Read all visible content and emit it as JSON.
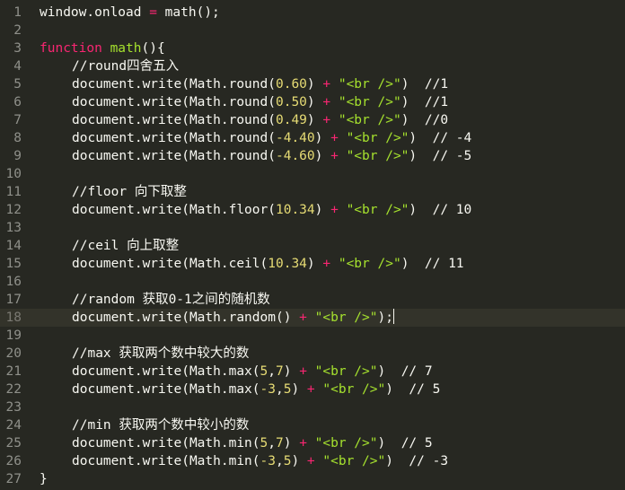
{
  "editor": {
    "active_line": 18,
    "lines": [
      {
        "no": "1",
        "tokens": [
          [
            "pl",
            "window.onload "
          ],
          [
            "op",
            "="
          ],
          [
            "pl",
            " math();"
          ]
        ]
      },
      {
        "no": "2",
        "tokens": []
      },
      {
        "no": "3",
        "tokens": [
          [
            "kw",
            "function "
          ],
          [
            "fn",
            "math"
          ],
          [
            "pl",
            "(){"
          ]
        ]
      },
      {
        "no": "4",
        "indent": 1,
        "tokens": [
          [
            "cm",
            "//round四舍五入"
          ]
        ]
      },
      {
        "no": "5",
        "indent": 1,
        "tokens": [
          [
            "pl",
            "document.write(Math.round("
          ],
          [
            "num",
            "0.60"
          ],
          [
            "pl",
            ") "
          ],
          [
            "op",
            "+"
          ],
          [
            "pl",
            " "
          ],
          [
            "str",
            "\"<br />\""
          ],
          [
            "pl",
            ")  //1"
          ]
        ]
      },
      {
        "no": "6",
        "indent": 1,
        "tokens": [
          [
            "pl",
            "document.write(Math.round("
          ],
          [
            "num",
            "0.50"
          ],
          [
            "pl",
            ") "
          ],
          [
            "op",
            "+"
          ],
          [
            "pl",
            " "
          ],
          [
            "str",
            "\"<br />\""
          ],
          [
            "pl",
            ")  //1"
          ]
        ]
      },
      {
        "no": "7",
        "indent": 1,
        "tokens": [
          [
            "pl",
            "document.write(Math.round("
          ],
          [
            "num",
            "0.49"
          ],
          [
            "pl",
            ") "
          ],
          [
            "op",
            "+"
          ],
          [
            "pl",
            " "
          ],
          [
            "str",
            "\"<br />\""
          ],
          [
            "pl",
            ")  //0"
          ]
        ]
      },
      {
        "no": "8",
        "indent": 1,
        "tokens": [
          [
            "pl",
            "document.write(Math.round("
          ],
          [
            "num",
            "-4.40"
          ],
          [
            "pl",
            ") "
          ],
          [
            "op",
            "+"
          ],
          [
            "pl",
            " "
          ],
          [
            "str",
            "\"<br />\""
          ],
          [
            "pl",
            ")  // -4"
          ]
        ]
      },
      {
        "no": "9",
        "indent": 1,
        "tokens": [
          [
            "pl",
            "document.write(Math.round("
          ],
          [
            "num",
            "-4.60"
          ],
          [
            "pl",
            ") "
          ],
          [
            "op",
            "+"
          ],
          [
            "pl",
            " "
          ],
          [
            "str",
            "\"<br />\""
          ],
          [
            "pl",
            ")  // -5"
          ]
        ]
      },
      {
        "no": "10",
        "tokens": []
      },
      {
        "no": "11",
        "indent": 1,
        "tokens": [
          [
            "cm",
            "//floor 向下取整"
          ]
        ]
      },
      {
        "no": "12",
        "indent": 1,
        "tokens": [
          [
            "pl",
            "document.write(Math.floor("
          ],
          [
            "num",
            "10.34"
          ],
          [
            "pl",
            ") "
          ],
          [
            "op",
            "+"
          ],
          [
            "pl",
            " "
          ],
          [
            "str",
            "\"<br />\""
          ],
          [
            "pl",
            ")  // 10"
          ]
        ]
      },
      {
        "no": "13",
        "tokens": []
      },
      {
        "no": "14",
        "indent": 1,
        "tokens": [
          [
            "cm",
            "//ceil 向上取整"
          ]
        ]
      },
      {
        "no": "15",
        "indent": 1,
        "tokens": [
          [
            "pl",
            "document.write(Math.ceil("
          ],
          [
            "num",
            "10.34"
          ],
          [
            "pl",
            ") "
          ],
          [
            "op",
            "+"
          ],
          [
            "pl",
            " "
          ],
          [
            "str",
            "\"<br />\""
          ],
          [
            "pl",
            ")  // 11"
          ]
        ]
      },
      {
        "no": "16",
        "tokens": []
      },
      {
        "no": "17",
        "indent": 1,
        "tokens": [
          [
            "cm",
            "//random 获取0-1之间的随机数"
          ]
        ]
      },
      {
        "no": "18",
        "indent": 1,
        "tokens": [
          [
            "pl",
            "document.write(Math.random() "
          ],
          [
            "op",
            "+"
          ],
          [
            "pl",
            " "
          ],
          [
            "str",
            "\"<br />\""
          ],
          [
            "pl",
            ");"
          ]
        ],
        "cursor": true
      },
      {
        "no": "19",
        "tokens": []
      },
      {
        "no": "20",
        "indent": 1,
        "tokens": [
          [
            "cm",
            "//max 获取两个数中较大的数"
          ]
        ]
      },
      {
        "no": "21",
        "indent": 1,
        "tokens": [
          [
            "pl",
            "document.write(Math.max("
          ],
          [
            "num",
            "5"
          ],
          [
            "pl",
            ","
          ],
          [
            "num",
            "7"
          ],
          [
            "pl",
            ") "
          ],
          [
            "op",
            "+"
          ],
          [
            "pl",
            " "
          ],
          [
            "str",
            "\"<br />\""
          ],
          [
            "pl",
            ")  // 7"
          ]
        ]
      },
      {
        "no": "22",
        "indent": 1,
        "tokens": [
          [
            "pl",
            "document.write(Math.max("
          ],
          [
            "num",
            "-3"
          ],
          [
            "pl",
            ","
          ],
          [
            "num",
            "5"
          ],
          [
            "pl",
            ") "
          ],
          [
            "op",
            "+"
          ],
          [
            "pl",
            " "
          ],
          [
            "str",
            "\"<br />\""
          ],
          [
            "pl",
            ")  // 5"
          ]
        ]
      },
      {
        "no": "23",
        "tokens": []
      },
      {
        "no": "24",
        "indent": 1,
        "tokens": [
          [
            "cm",
            "//min 获取两个数中较小的数"
          ]
        ]
      },
      {
        "no": "25",
        "indent": 1,
        "tokens": [
          [
            "pl",
            "document.write(Math.min("
          ],
          [
            "num",
            "5"
          ],
          [
            "pl",
            ","
          ],
          [
            "num",
            "7"
          ],
          [
            "pl",
            ") "
          ],
          [
            "op",
            "+"
          ],
          [
            "pl",
            " "
          ],
          [
            "str",
            "\"<br />\""
          ],
          [
            "pl",
            ")  // 5"
          ]
        ]
      },
      {
        "no": "26",
        "indent": 1,
        "tokens": [
          [
            "pl",
            "document.write(Math.min("
          ],
          [
            "num",
            "-3"
          ],
          [
            "pl",
            ","
          ],
          [
            "num",
            "5"
          ],
          [
            "pl",
            ") "
          ],
          [
            "op",
            "+"
          ],
          [
            "pl",
            " "
          ],
          [
            "str",
            "\"<br />\""
          ],
          [
            "pl",
            ")  // -3"
          ]
        ]
      },
      {
        "no": "27",
        "tokens": [
          [
            "pl",
            "}"
          ]
        ]
      }
    ]
  }
}
